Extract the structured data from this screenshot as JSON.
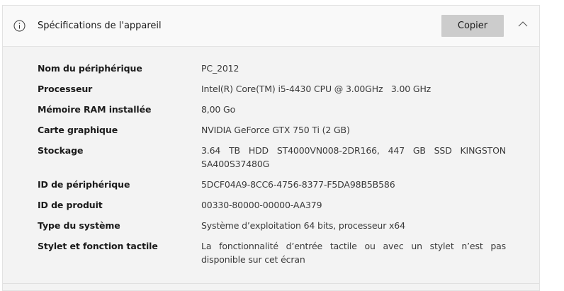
{
  "header": {
    "icon": "info-icon",
    "title": "Spécifications de l'appareil",
    "copy_label": "Copier",
    "collapse_icon": "chevron-up-icon"
  },
  "specs": [
    {
      "label": "Nom du périphérique",
      "value": "PC_2012"
    },
    {
      "label": "Processeur",
      "value": "Intel(R) Core(TM) i5-4430 CPU @ 3.00GHz   3.00 GHz"
    },
    {
      "label": "Mémoire RAM installée",
      "value": "8,00 Go"
    },
    {
      "label": "Carte graphique",
      "value": "NVIDIA GeForce GTX 750 Ti (2 GB)"
    },
    {
      "label": "Stockage",
      "value": "3.64 TB HDD ST4000VN008-2DR166, 447 GB SSD KINGSTON SA400S37480G"
    },
    {
      "label": "ID de périphérique",
      "value": "5DCF04A9-8CC6-4756-8377-F5DA98B5B586"
    },
    {
      "label": "ID de produit",
      "value": "00330-80000-00000-AA379"
    },
    {
      "label": "Type du système",
      "value": "Système d’exploitation 64 bits, processeur x64"
    },
    {
      "label": "Stylet et fonction tactile",
      "value": "La fonctionnalité d’entrée tactile ou avec un stylet n’est pas disponible sur cet écran"
    }
  ]
}
